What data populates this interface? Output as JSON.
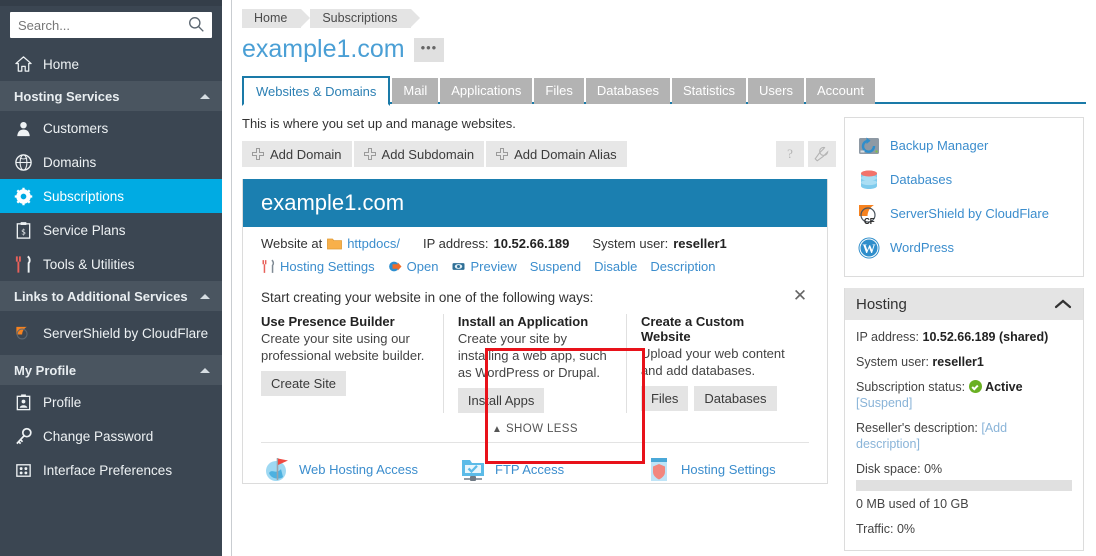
{
  "sidebar": {
    "search": {
      "placeholder": "Search...",
      "value": "",
      "icon": "search-icon"
    },
    "home": {
      "label": "Home",
      "icon": "home-icon"
    },
    "sections": [
      {
        "label": "Hosting Services",
        "icon": "chevron-up-icon",
        "items": [
          {
            "label": "Customers",
            "icon": "user-icon",
            "active": false
          },
          {
            "label": "Domains",
            "icon": "globe-icon",
            "active": false
          },
          {
            "label": "Subscriptions",
            "icon": "gear-icon",
            "active": true
          },
          {
            "label": "Service Plans",
            "icon": "clipboard-icon",
            "active": false
          },
          {
            "label": "Tools & Utilities",
            "icon": "tools-icon",
            "active": false
          }
        ]
      },
      {
        "label": "Links to Additional Services",
        "icon": "chevron-up-icon",
        "items": [
          {
            "label": "ServerShield by CloudFlare",
            "icon": "cloudflare-icon",
            "active": false
          }
        ]
      },
      {
        "label": "My Profile",
        "icon": "chevron-up-icon",
        "items": [
          {
            "label": "Profile",
            "icon": "profile-icon",
            "active": false
          },
          {
            "label": "Change Password",
            "icon": "key-icon",
            "active": false
          },
          {
            "label": "Interface Preferences",
            "icon": "grid-icon",
            "active": false
          }
        ]
      }
    ]
  },
  "breadcrumb": [
    {
      "label": "Home"
    },
    {
      "label": "Subscriptions"
    }
  ],
  "page": {
    "title": "example1.com",
    "more_button": "•••",
    "intro": "This is where you set up and manage websites."
  },
  "tabs": [
    {
      "label": "Websites & Domains",
      "active": true
    },
    {
      "label": "Mail",
      "active": false
    },
    {
      "label": "Applications",
      "active": false
    },
    {
      "label": "Files",
      "active": false
    },
    {
      "label": "Databases",
      "active": false
    },
    {
      "label": "Statistics",
      "active": false
    },
    {
      "label": "Users",
      "active": false
    },
    {
      "label": "Account",
      "active": false
    }
  ],
  "toolbar": {
    "add_domain": "Add Domain",
    "add_subdomain": "Add Subdomain",
    "add_domain_alias": "Add Domain Alias",
    "help_icon": "question-mark-icon",
    "wrench_icon": "wrench-icon"
  },
  "site": {
    "header": "example1.com",
    "website_at_label": "Website at",
    "docroot": "httpdocs/",
    "ip_label": "IP address:",
    "ip_value": "10.52.66.189",
    "sysuser_label": "System user:",
    "sysuser_value": "reseller1",
    "links": [
      {
        "label": "Hosting Settings",
        "icon": "tools-icon"
      },
      {
        "label": "Open",
        "icon": "arrow-globe-icon"
      },
      {
        "label": "Preview",
        "icon": "eye-icon"
      },
      {
        "label": "Suspend",
        "icon": ""
      },
      {
        "label": "Disable",
        "icon": ""
      },
      {
        "label": "Description",
        "icon": ""
      }
    ]
  },
  "creating": {
    "title": "Start creating your website in one of the following ways:",
    "close_icon": "close-icon",
    "ways": [
      {
        "heading": "Use Presence Builder",
        "text": "Create your site using our professional website builder.",
        "buttons": [
          "Create Site"
        ],
        "highlighted": true
      },
      {
        "heading": "Install an Application",
        "text": "Create your site by installing a web app, such as WordPress or Drupal.",
        "buttons": [
          "Install Apps"
        ],
        "highlighted": false
      },
      {
        "heading": "Create a Custom Website",
        "text": "Upload your web content and add databases.",
        "buttons": [
          "Files",
          "Databases"
        ],
        "highlighted": false
      }
    ],
    "show_less": "SHOW LESS",
    "show_less_icon": "chevron-up-icon"
  },
  "bottom_links": [
    {
      "label": "Web Hosting Access",
      "icon": "globe-flag-icon"
    },
    {
      "label": "FTP Access",
      "icon": "ftp-folder-icon"
    },
    {
      "label": "Hosting Settings",
      "icon": "shield-doc-icon"
    }
  ],
  "right_panel": {
    "links": [
      {
        "label": "Backup Manager",
        "icon": "backup-icon"
      },
      {
        "label": "Databases",
        "icon": "database-icon"
      },
      {
        "label": "ServerShield by CloudFlare",
        "icon": "cloudflare-icon"
      },
      {
        "label": "WordPress",
        "icon": "wordpress-icon"
      }
    ],
    "hosting": {
      "title": "Hosting",
      "collapse_icon": "chevron-up-icon",
      "ip_label": "IP address:",
      "ip_value": "10.52.66.189 (shared)",
      "sysuser_label": "System user:",
      "sysuser_value": "reseller1",
      "status_label": "Subscription status:",
      "status_value": "Active",
      "suspend_link": "[Suspend]",
      "reseller_label": "Reseller's description:",
      "reseller_link": "[Add description]",
      "disk_label": "Disk space: 0%",
      "disk_usage": "0 MB used of 10 GB",
      "traffic_label": "Traffic: 0%",
      "disk_percent": 0
    }
  },
  "colors": {
    "sidebar_bg": "#3b4652",
    "accent_blue": "#00abe3",
    "link_blue": "#3b8dcd",
    "site_header_blue": "#1b7fb0",
    "highlight_red": "#e8121a",
    "status_green": "#6ab023"
  }
}
